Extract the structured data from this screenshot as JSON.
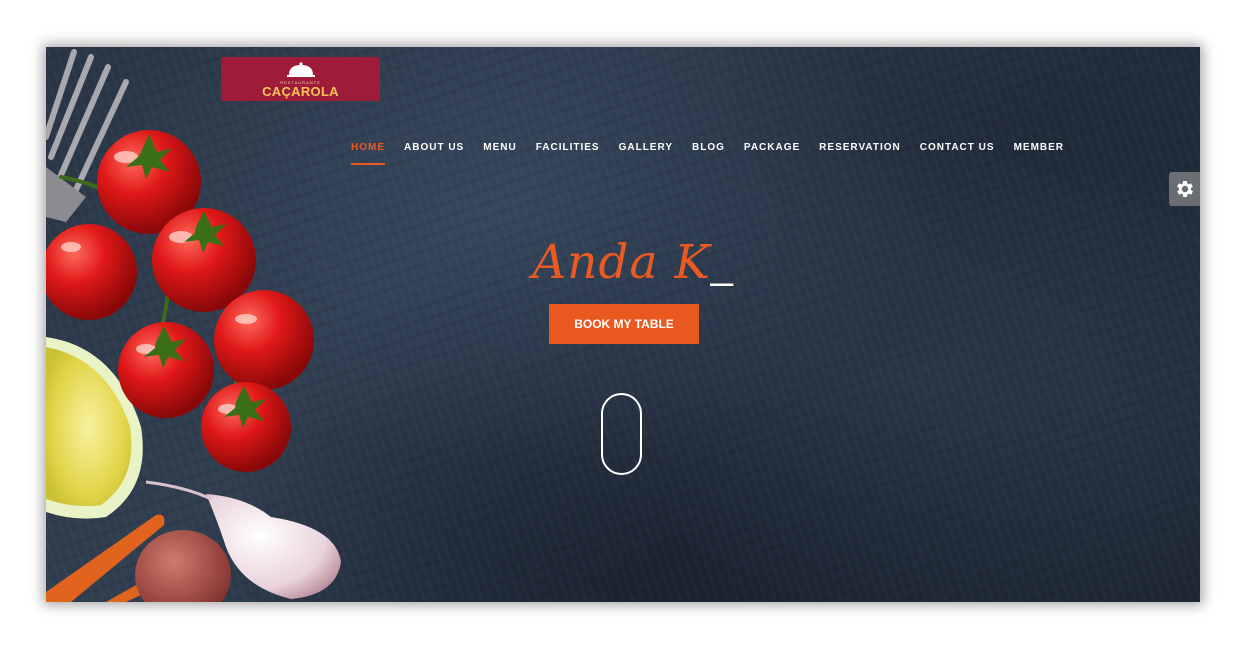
{
  "brand": {
    "sub": "RESTAURANTE",
    "name": "CAÇAROLA"
  },
  "nav": {
    "items": [
      {
        "label": "HOME",
        "active": true
      },
      {
        "label": "ABOUT US"
      },
      {
        "label": "MENU"
      },
      {
        "label": "FACILITIES"
      },
      {
        "label": "GALLERY"
      },
      {
        "label": "BLOG"
      },
      {
        "label": "PACKAGE"
      },
      {
        "label": "RESERVATION"
      },
      {
        "label": "CONTACT US"
      },
      {
        "label": "MEMBER"
      }
    ]
  },
  "hero": {
    "title": "Anda K",
    "cursor": "_",
    "button_label": "BOOK MY TABLE"
  },
  "icons": {
    "settings": "gear-icon",
    "scroll": "mouse-scroll-icon",
    "logo": "cloche-icon"
  },
  "colors": {
    "accent": "#ec5a24",
    "logo_bg": "#9e1c3a",
    "logo_text": "#f7c65a",
    "background": "#2a3646"
  }
}
